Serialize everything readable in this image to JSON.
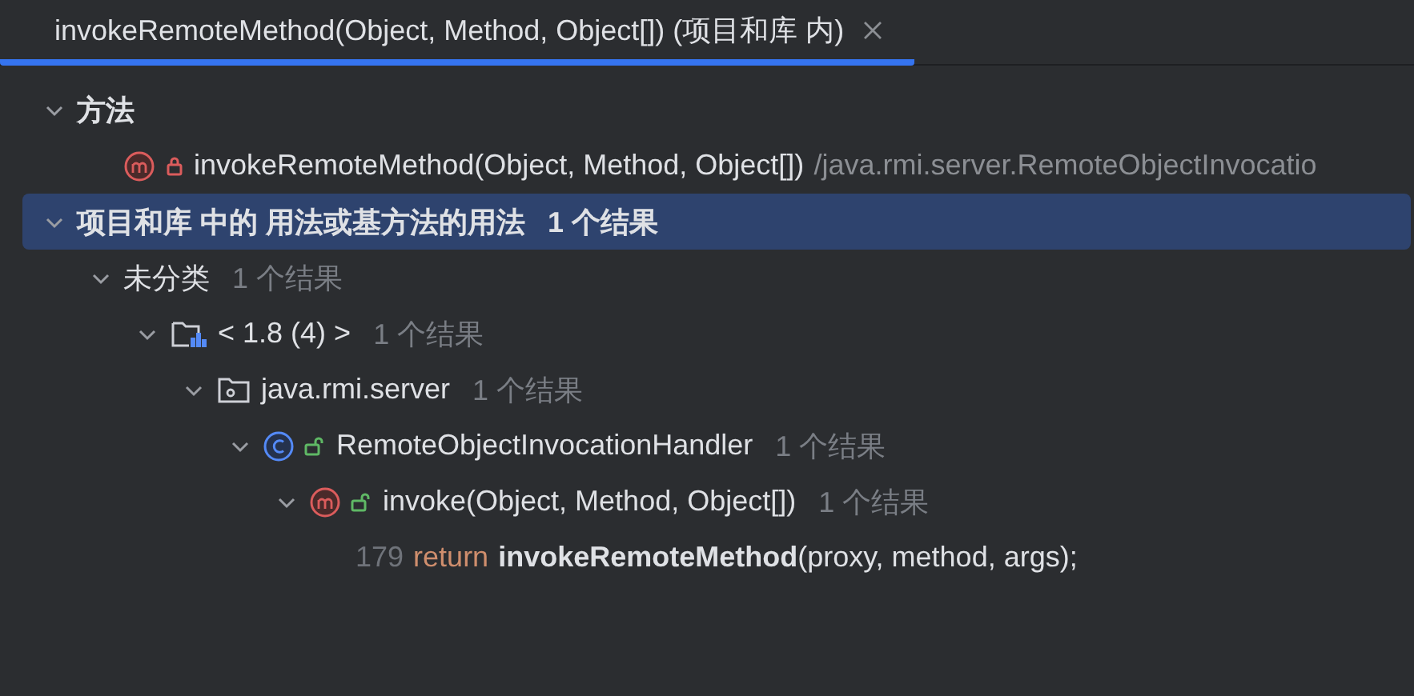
{
  "tab": {
    "title": "invokeRemoteMethod(Object, Method, Object[]) (项目和库 内)",
    "selected": true
  },
  "tree": [
    {
      "kind": "group",
      "label": "方法",
      "expanded": true,
      "selected": false,
      "children": [
        {
          "kind": "method",
          "locked": true,
          "label": "invokeRemoteMethod(Object, Method, Object[])",
          "path": "/java.rmi.server.RemoteObjectInvocatio"
        }
      ]
    },
    {
      "kind": "group",
      "label": "项目和库 中的 用法或基方法的用法",
      "count": "1 个结果",
      "expanded": true,
      "selected": true,
      "children": [
        {
          "kind": "category",
          "label": "未分类",
          "count": "1 个结果",
          "expanded": true,
          "selected": false,
          "children": [
            {
              "kind": "module",
              "label": "< 1.8 (4) >",
              "count": "1 个结果",
              "expanded": true,
              "selected": false,
              "children": [
                {
                  "kind": "package",
                  "label": "java.rmi.server",
                  "count": "1 个结果",
                  "expanded": true,
                  "selected": false,
                  "children": [
                    {
                      "kind": "class",
                      "locked": false,
                      "label": "RemoteObjectInvocationHandler",
                      "count": "1 个结果",
                      "expanded": true,
                      "selected": false,
                      "children": [
                        {
                          "kind": "method",
                          "locked": false,
                          "label": "invoke(Object, Method, Object[])",
                          "count": "1 个结果",
                          "expanded": true,
                          "selected": false,
                          "children": [
                            {
                              "kind": "usage",
                              "line": "179",
                              "keyword": "return",
                              "code": "**invokeRemoteMethod**(proxy, method, args);"
                            }
                          ]
                        }
                      ]
                    }
                  ]
                }
              ]
            }
          ]
        }
      ]
    }
  ]
}
